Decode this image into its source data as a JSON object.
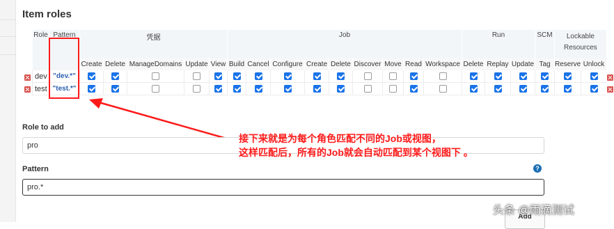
{
  "section_title": "Item roles",
  "table": {
    "role_header": "Role",
    "pattern_header": "Pattern",
    "groups": [
      {
        "label": "凭据",
        "span": 5
      },
      {
        "label": "Job",
        "span": 9
      },
      {
        "label": "Run",
        "span": 3
      },
      {
        "label": "SCM",
        "span": 1
      },
      {
        "label": "Lockable Resources",
        "span": 2
      }
    ],
    "permissions": [
      "Create",
      "Delete",
      "ManageDomains",
      "Update",
      "View",
      "Build",
      "Cancel",
      "Configure",
      "Create",
      "Delete",
      "Discover",
      "Move",
      "Read",
      "Workspace",
      "Delete",
      "Replay",
      "Update",
      "Tag",
      "Reserve",
      "Unlock"
    ],
    "rows": [
      {
        "name": "dev",
        "pattern": "\"dev.*\"",
        "checks": [
          1,
          1,
          0,
          0,
          1,
          1,
          1,
          1,
          1,
          1,
          0,
          0,
          1,
          0,
          1,
          1,
          1,
          1,
          1,
          1
        ]
      },
      {
        "name": "test",
        "pattern": "\"test.*\"",
        "checks": [
          1,
          1,
          0,
          0,
          1,
          1,
          1,
          1,
          1,
          1,
          0,
          0,
          1,
          0,
          1,
          1,
          1,
          1,
          1,
          1
        ]
      }
    ]
  },
  "role_to_add": {
    "label": "Role to add",
    "value": "pro"
  },
  "pattern_field": {
    "label": "Pattern",
    "value": "pro.*",
    "help": "?"
  },
  "annotation": {
    "line1": "接下来就是为每个角色匹配不同的Job或视图，",
    "line2": "这样匹配后，所有的Job就会自动匹配到某个视图下 。"
  },
  "add_button": "Add",
  "watermark": "头条 @雨滴测试",
  "colors": {
    "accent": "#1a73e8",
    "annotation": "#ff1a1a",
    "delete": "#d9534f",
    "header_bg": "#f2f6f8"
  }
}
